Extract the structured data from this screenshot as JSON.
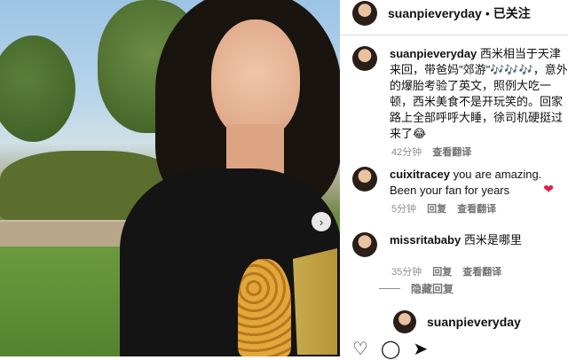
{
  "post": {
    "username": "suanpieveryday",
    "separator": "•",
    "follow_label": "已关注"
  },
  "caption": {
    "username": "suanpieveryday",
    "text": "西米相当于天津来回，带爸妈\"郊游\"🎶🎶🎶，意外的爆胎考验了英文，照例大吃一顿，西米美食不是开玩笑的。回家路上全部呼呼大睡，徐司机硬挺过来了😂",
    "time": "42分钟",
    "translate": "查看翻译"
  },
  "comments": [
    {
      "username": "cuixitracey",
      "text": "you are amazing. Been your fan for years",
      "heart": "❤",
      "time": "5分钟",
      "reply": "回复",
      "translate": "查看翻译"
    },
    {
      "username": "missritababy",
      "text": "西米是哪里",
      "time": "35分钟",
      "reply": "回复",
      "translate": "查看翻译"
    }
  ],
  "hidden_replies": "隐藏回复",
  "nested_reply_username": "suanpieveryday",
  "photo_next": "›",
  "icons": {
    "like": "♡",
    "comment": "◯",
    "share": "➤"
  },
  "colors": {
    "heart_red": "#e41e3f",
    "text_main": "#111111",
    "text_muted": "#8e8e8e"
  }
}
